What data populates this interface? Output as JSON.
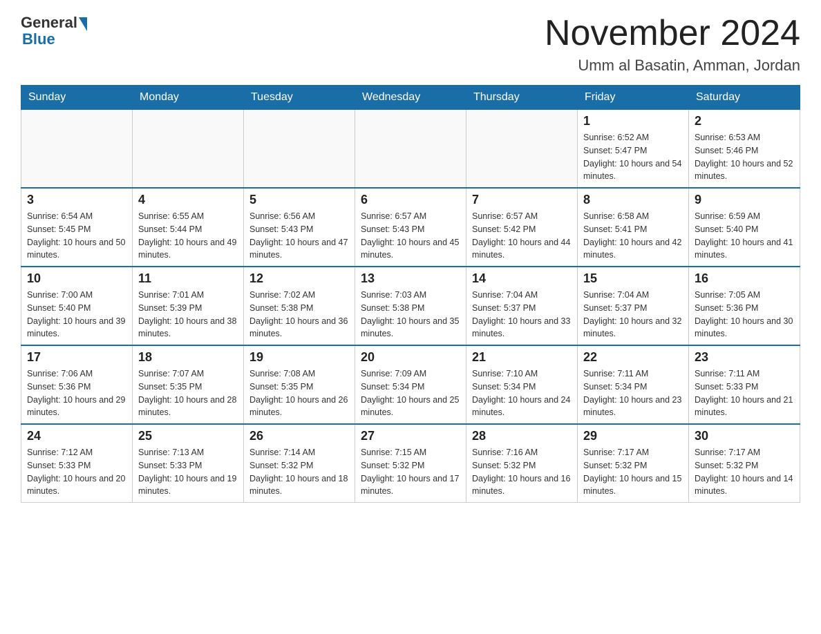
{
  "header": {
    "logo_general": "General",
    "logo_blue": "Blue",
    "month_title": "November 2024",
    "location": "Umm al Basatin, Amman, Jordan"
  },
  "days_of_week": [
    "Sunday",
    "Monday",
    "Tuesday",
    "Wednesday",
    "Thursday",
    "Friday",
    "Saturday"
  ],
  "weeks": [
    [
      {
        "num": "",
        "sunrise": "",
        "sunset": "",
        "daylight": ""
      },
      {
        "num": "",
        "sunrise": "",
        "sunset": "",
        "daylight": ""
      },
      {
        "num": "",
        "sunrise": "",
        "sunset": "",
        "daylight": ""
      },
      {
        "num": "",
        "sunrise": "",
        "sunset": "",
        "daylight": ""
      },
      {
        "num": "",
        "sunrise": "",
        "sunset": "",
        "daylight": ""
      },
      {
        "num": "1",
        "sunrise": "Sunrise: 6:52 AM",
        "sunset": "Sunset: 5:47 PM",
        "daylight": "Daylight: 10 hours and 54 minutes."
      },
      {
        "num": "2",
        "sunrise": "Sunrise: 6:53 AM",
        "sunset": "Sunset: 5:46 PM",
        "daylight": "Daylight: 10 hours and 52 minutes."
      }
    ],
    [
      {
        "num": "3",
        "sunrise": "Sunrise: 6:54 AM",
        "sunset": "Sunset: 5:45 PM",
        "daylight": "Daylight: 10 hours and 50 minutes."
      },
      {
        "num": "4",
        "sunrise": "Sunrise: 6:55 AM",
        "sunset": "Sunset: 5:44 PM",
        "daylight": "Daylight: 10 hours and 49 minutes."
      },
      {
        "num": "5",
        "sunrise": "Sunrise: 6:56 AM",
        "sunset": "Sunset: 5:43 PM",
        "daylight": "Daylight: 10 hours and 47 minutes."
      },
      {
        "num": "6",
        "sunrise": "Sunrise: 6:57 AM",
        "sunset": "Sunset: 5:43 PM",
        "daylight": "Daylight: 10 hours and 45 minutes."
      },
      {
        "num": "7",
        "sunrise": "Sunrise: 6:57 AM",
        "sunset": "Sunset: 5:42 PM",
        "daylight": "Daylight: 10 hours and 44 minutes."
      },
      {
        "num": "8",
        "sunrise": "Sunrise: 6:58 AM",
        "sunset": "Sunset: 5:41 PM",
        "daylight": "Daylight: 10 hours and 42 minutes."
      },
      {
        "num": "9",
        "sunrise": "Sunrise: 6:59 AM",
        "sunset": "Sunset: 5:40 PM",
        "daylight": "Daylight: 10 hours and 41 minutes."
      }
    ],
    [
      {
        "num": "10",
        "sunrise": "Sunrise: 7:00 AM",
        "sunset": "Sunset: 5:40 PM",
        "daylight": "Daylight: 10 hours and 39 minutes."
      },
      {
        "num": "11",
        "sunrise": "Sunrise: 7:01 AM",
        "sunset": "Sunset: 5:39 PM",
        "daylight": "Daylight: 10 hours and 38 minutes."
      },
      {
        "num": "12",
        "sunrise": "Sunrise: 7:02 AM",
        "sunset": "Sunset: 5:38 PM",
        "daylight": "Daylight: 10 hours and 36 minutes."
      },
      {
        "num": "13",
        "sunrise": "Sunrise: 7:03 AM",
        "sunset": "Sunset: 5:38 PM",
        "daylight": "Daylight: 10 hours and 35 minutes."
      },
      {
        "num": "14",
        "sunrise": "Sunrise: 7:04 AM",
        "sunset": "Sunset: 5:37 PM",
        "daylight": "Daylight: 10 hours and 33 minutes."
      },
      {
        "num": "15",
        "sunrise": "Sunrise: 7:04 AM",
        "sunset": "Sunset: 5:37 PM",
        "daylight": "Daylight: 10 hours and 32 minutes."
      },
      {
        "num": "16",
        "sunrise": "Sunrise: 7:05 AM",
        "sunset": "Sunset: 5:36 PM",
        "daylight": "Daylight: 10 hours and 30 minutes."
      }
    ],
    [
      {
        "num": "17",
        "sunrise": "Sunrise: 7:06 AM",
        "sunset": "Sunset: 5:36 PM",
        "daylight": "Daylight: 10 hours and 29 minutes."
      },
      {
        "num": "18",
        "sunrise": "Sunrise: 7:07 AM",
        "sunset": "Sunset: 5:35 PM",
        "daylight": "Daylight: 10 hours and 28 minutes."
      },
      {
        "num": "19",
        "sunrise": "Sunrise: 7:08 AM",
        "sunset": "Sunset: 5:35 PM",
        "daylight": "Daylight: 10 hours and 26 minutes."
      },
      {
        "num": "20",
        "sunrise": "Sunrise: 7:09 AM",
        "sunset": "Sunset: 5:34 PM",
        "daylight": "Daylight: 10 hours and 25 minutes."
      },
      {
        "num": "21",
        "sunrise": "Sunrise: 7:10 AM",
        "sunset": "Sunset: 5:34 PM",
        "daylight": "Daylight: 10 hours and 24 minutes."
      },
      {
        "num": "22",
        "sunrise": "Sunrise: 7:11 AM",
        "sunset": "Sunset: 5:34 PM",
        "daylight": "Daylight: 10 hours and 23 minutes."
      },
      {
        "num": "23",
        "sunrise": "Sunrise: 7:11 AM",
        "sunset": "Sunset: 5:33 PM",
        "daylight": "Daylight: 10 hours and 21 minutes."
      }
    ],
    [
      {
        "num": "24",
        "sunrise": "Sunrise: 7:12 AM",
        "sunset": "Sunset: 5:33 PM",
        "daylight": "Daylight: 10 hours and 20 minutes."
      },
      {
        "num": "25",
        "sunrise": "Sunrise: 7:13 AM",
        "sunset": "Sunset: 5:33 PM",
        "daylight": "Daylight: 10 hours and 19 minutes."
      },
      {
        "num": "26",
        "sunrise": "Sunrise: 7:14 AM",
        "sunset": "Sunset: 5:32 PM",
        "daylight": "Daylight: 10 hours and 18 minutes."
      },
      {
        "num": "27",
        "sunrise": "Sunrise: 7:15 AM",
        "sunset": "Sunset: 5:32 PM",
        "daylight": "Daylight: 10 hours and 17 minutes."
      },
      {
        "num": "28",
        "sunrise": "Sunrise: 7:16 AM",
        "sunset": "Sunset: 5:32 PM",
        "daylight": "Daylight: 10 hours and 16 minutes."
      },
      {
        "num": "29",
        "sunrise": "Sunrise: 7:17 AM",
        "sunset": "Sunset: 5:32 PM",
        "daylight": "Daylight: 10 hours and 15 minutes."
      },
      {
        "num": "30",
        "sunrise": "Sunrise: 7:17 AM",
        "sunset": "Sunset: 5:32 PM",
        "daylight": "Daylight: 10 hours and 14 minutes."
      }
    ]
  ]
}
